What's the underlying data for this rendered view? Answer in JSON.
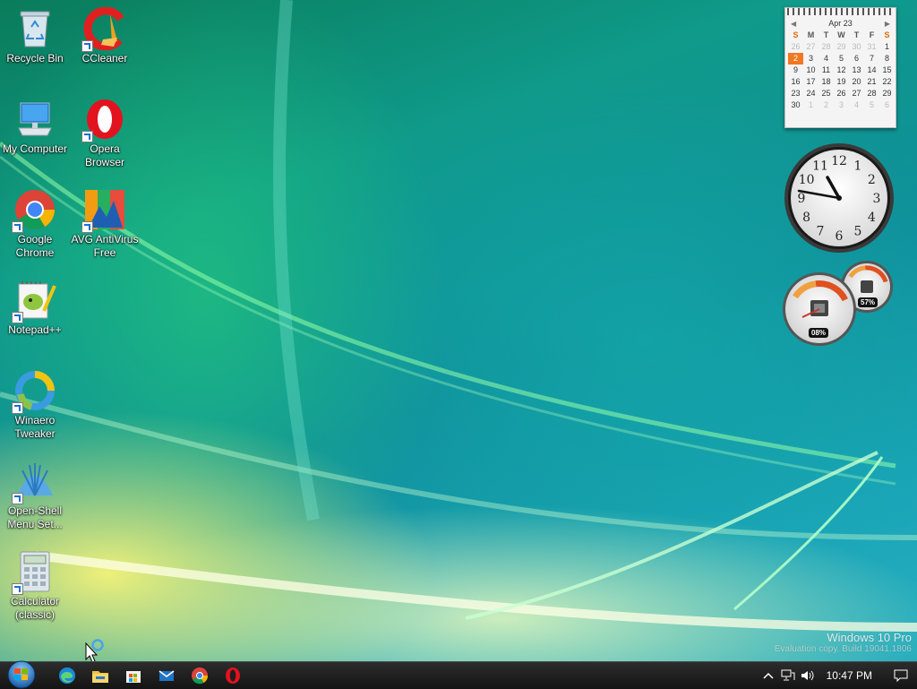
{
  "desktop": {
    "icons": [
      {
        "label": "Recycle Bin",
        "icon": "recycle-bin-icon"
      },
      {
        "label": "CCleaner",
        "icon": "ccleaner-icon"
      },
      {
        "label": "My Computer",
        "icon": "my-computer-icon"
      },
      {
        "label": "Opera Browser",
        "icon": "opera-icon"
      },
      {
        "label": "Google Chrome",
        "icon": "chrome-icon"
      },
      {
        "label": "AVG AntiVirus Free",
        "icon": "avg-icon"
      },
      {
        "label": "Notepad++",
        "icon": "notepadpp-icon"
      },
      {
        "label": "Winaero Tweaker",
        "icon": "winaero-icon"
      },
      {
        "label": "Open-Shell Menu Set...",
        "icon": "openshell-icon"
      },
      {
        "label": "Calculator (classic)",
        "icon": "calculator-icon"
      }
    ]
  },
  "gadgets": {
    "calendar": {
      "month_label": "Apr 23",
      "weekdays": [
        "S",
        "M",
        "T",
        "W",
        "T",
        "F",
        "S"
      ],
      "weeks": [
        [
          "26",
          "27",
          "28",
          "29",
          "30",
          "31",
          "1"
        ],
        [
          "2",
          "3",
          "4",
          "5",
          "6",
          "7",
          "8"
        ],
        [
          "9",
          "10",
          "11",
          "12",
          "13",
          "14",
          "15"
        ],
        [
          "16",
          "17",
          "18",
          "19",
          "20",
          "21",
          "22"
        ],
        [
          "23",
          "24",
          "25",
          "26",
          "27",
          "28",
          "29"
        ],
        [
          "30",
          "1",
          "2",
          "3",
          "4",
          "5",
          "6"
        ]
      ],
      "today": "2"
    },
    "clock": {
      "numerals": [
        "12",
        "1",
        "2",
        "3",
        "4",
        "5",
        "6",
        "7",
        "8",
        "9",
        "10",
        "11"
      ],
      "time": "10:47"
    },
    "cpu_meter": {
      "cpu_label": "08%",
      "ram_label": "57%",
      "cpu_value": 0.08,
      "ram_value": 0.57
    }
  },
  "watermark": {
    "line1": "Windows 10 Pro",
    "line2": "Evaluation copy. Build 19041.1806"
  },
  "taskbar": {
    "start_icon": "windows-orb-icon",
    "apps": [
      "edge-icon",
      "file-explorer-icon",
      "store-icon",
      "mail-icon",
      "chrome-icon",
      "opera-icon"
    ],
    "tray": {
      "time": "10:47 PM"
    }
  },
  "colors": {
    "today_highlight": "#f07820",
    "taskbar": "#1e1e1e"
  }
}
